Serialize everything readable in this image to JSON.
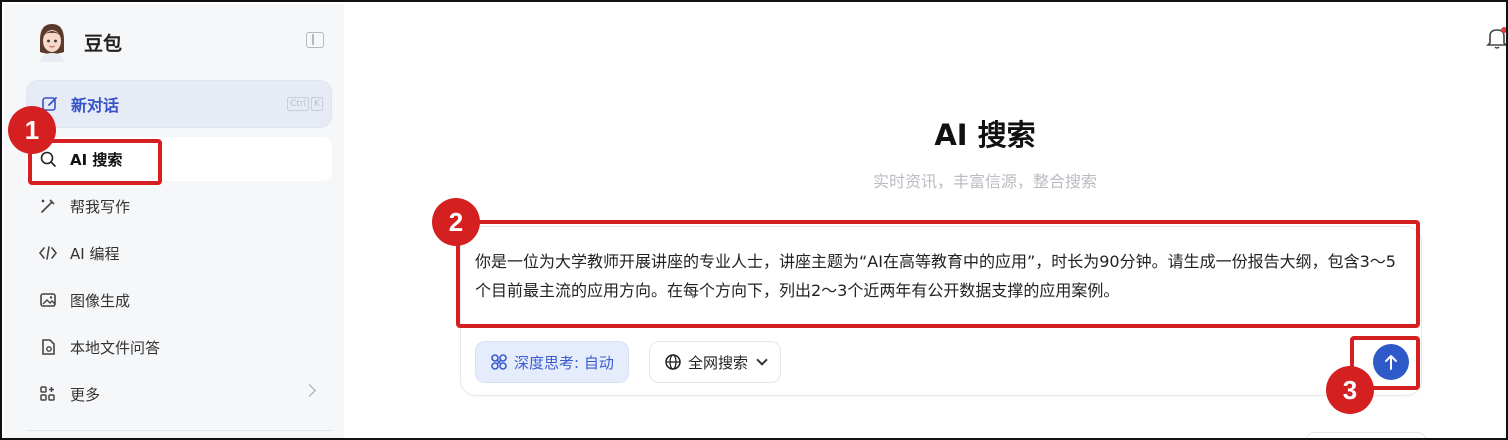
{
  "app": {
    "name": "豆包"
  },
  "sidebar": {
    "new_chat": {
      "label": "新对话",
      "shortcut": [
        "Ctrl",
        "K"
      ]
    },
    "items": [
      {
        "label": "AI 搜索",
        "icon": "search-icon",
        "active": true
      },
      {
        "label": "帮我写作",
        "icon": "pen-sparkle-icon"
      },
      {
        "label": "AI 编程",
        "icon": "code-icon"
      },
      {
        "label": "图像生成",
        "icon": "image-icon"
      },
      {
        "label": "本地文件问答",
        "icon": "file-icon"
      },
      {
        "label": "更多",
        "icon": "grid-plus-icon"
      }
    ]
  },
  "main": {
    "title": "AI 搜索",
    "subtitle": "实时资讯，丰富信源，整合搜索",
    "prompt": "你是一位为大学教师开展讲座的专业人士，讲座主题为“AI在高等教育中的应用”，时长为90分钟。请生成一份报告大纲，包含3～5个目前最主流的应用方向。在每个方向下，列出2～3个近两年有公开数据支撑的应用案例。",
    "deep_think_label": "深度思考: 自动",
    "web_search_label": "全网搜索"
  },
  "annotations": {
    "step1": "1",
    "step2": "2",
    "step3": "3"
  },
  "colors": {
    "accent": "#2d5ac8",
    "annotation": "#d42020",
    "sidebar_bg": "#f6f7f9"
  }
}
